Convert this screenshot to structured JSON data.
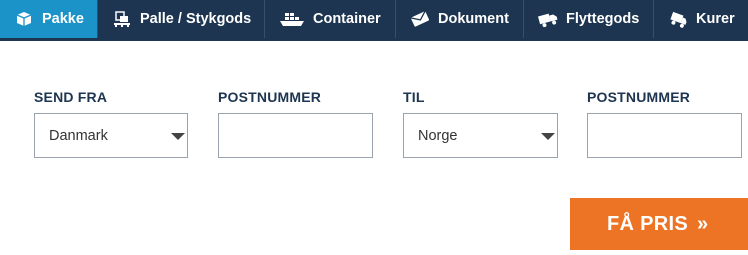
{
  "tabs": [
    {
      "label": "Pakke",
      "icon": "package-icon",
      "active": true
    },
    {
      "label": "Palle / Stykgods",
      "icon": "pallet-icon",
      "active": false
    },
    {
      "label": "Container",
      "icon": "ship-icon",
      "active": false
    },
    {
      "label": "Dokument",
      "icon": "envelope-icon",
      "active": false
    },
    {
      "label": "Flyttegods",
      "icon": "moving-truck-icon",
      "active": false
    },
    {
      "label": "Kurer",
      "icon": "courier-icon",
      "active": false
    }
  ],
  "form": {
    "send_from_label": "SEND FRA",
    "send_from_value": "Danmark",
    "from_postcode_label": "POSTNUMMER",
    "from_postcode_value": "",
    "to_label": "TIL",
    "to_value": "Norge",
    "to_postcode_label": "POSTNUMMER",
    "to_postcode_value": ""
  },
  "submit_label": "FÅ PRIS",
  "submit_icon": "double-chevron-right-icon",
  "colors": {
    "nav_bg": "#1d3550",
    "active_tab": "#1b93c8",
    "label_text": "#1d3550",
    "cta": "#ec7424"
  }
}
